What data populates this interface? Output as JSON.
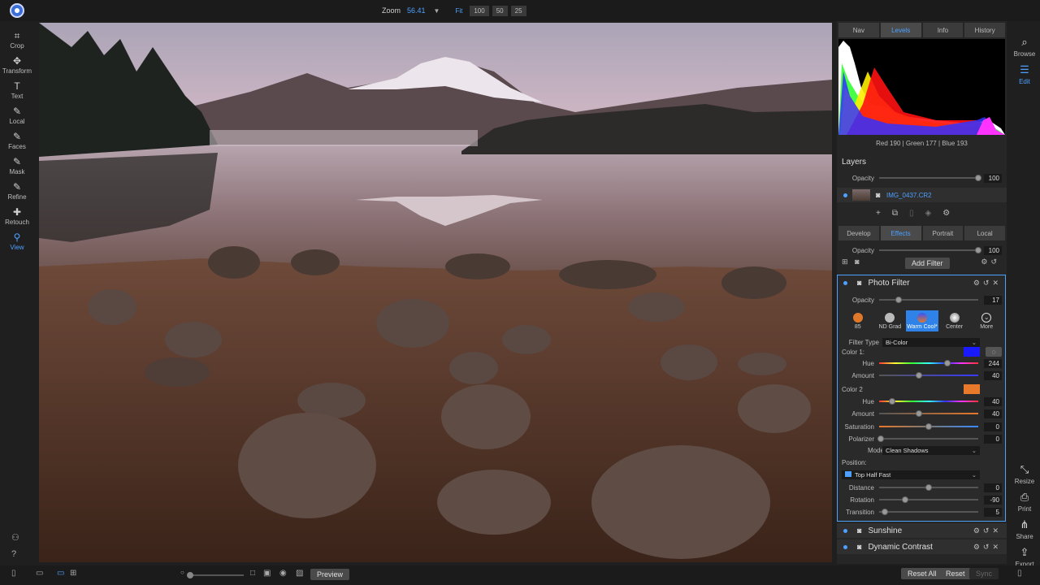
{
  "topbar": {
    "zoom_label": "Zoom",
    "zoom_value": "56.41",
    "zoom_buttons": [
      "Fit",
      "100",
      "50",
      "25"
    ]
  },
  "left_tools": [
    {
      "label": "Crop",
      "icon": "crop-icon"
    },
    {
      "label": "Transform",
      "icon": "transform-icon"
    },
    {
      "label": "Text",
      "icon": "text-icon"
    },
    {
      "label": "Local",
      "icon": "brush-icon"
    },
    {
      "label": "Faces",
      "icon": "faces-icon"
    },
    {
      "label": "Mask",
      "icon": "mask-icon"
    },
    {
      "label": "Refine",
      "icon": "refine-icon"
    },
    {
      "label": "Retouch",
      "icon": "retouch-icon"
    },
    {
      "label": "View",
      "icon": "view-icon",
      "active": true
    }
  ],
  "right_rail": {
    "browse": "Browse",
    "edit": "Edit",
    "resize": "Resize",
    "print": "Print",
    "share": "Share",
    "export": "Export"
  },
  "panel": {
    "top_tabs": [
      "Nav",
      "Levels",
      "Info",
      "History"
    ],
    "active_top_tab": "Levels",
    "rgb_readout": "Red 190 | Green 177 | Blue 193",
    "layers_title": "Layers",
    "layers_opacity_label": "Opacity",
    "layers_opacity_value": "100",
    "layer_name": "IMG_0437.CR2",
    "sub_tabs": [
      "Develop",
      "Effects",
      "Portrait",
      "Local"
    ],
    "active_sub_tab": "Effects",
    "effects_opacity_label": "Opacity",
    "effects_opacity_value": "100",
    "add_filter": "Add Filter",
    "photo_filter": {
      "title": "Photo Filter",
      "opacity_label": "Opacity",
      "opacity_value": "17",
      "presets": [
        "85",
        "ND Grad",
        "Warm Cool*",
        "Center",
        "More"
      ],
      "filter_type_label": "Filter Type",
      "filter_type_value": "Bi-Color",
      "color1_label": "Color 1:",
      "color1_hex": "#1a1aff",
      "hue1_label": "Hue",
      "hue1_value": "244",
      "amount1_label": "Amount",
      "amount1_value": "40",
      "color2_label": "Color 2",
      "color2_hex": "#e8782a",
      "hue2_label": "Hue",
      "hue2_value": "40",
      "amount2_label": "Amount",
      "amount2_value": "40",
      "saturation_label": "Saturation",
      "saturation_value": "0",
      "polarizer_label": "Polarizer",
      "polarizer_value": "0",
      "mode_label": "Mode",
      "mode_value": "Clean Shadows",
      "position_label": "Position:",
      "position_value": "Top Half Fast",
      "distance_label": "Distance",
      "distance_value": "0",
      "rotation_label": "Rotation",
      "rotation_value": "-90",
      "transition_label": "Transition",
      "transition_value": "5"
    },
    "filters_below": [
      "Sunshine",
      "Dynamic Contrast"
    ]
  },
  "bottombar": {
    "preview": "Preview",
    "reset_all": "Reset All",
    "reset": "Reset",
    "sync": "Sync"
  },
  "colors": {
    "accent": "#4ea0ff",
    "panel_bg": "#262626"
  }
}
